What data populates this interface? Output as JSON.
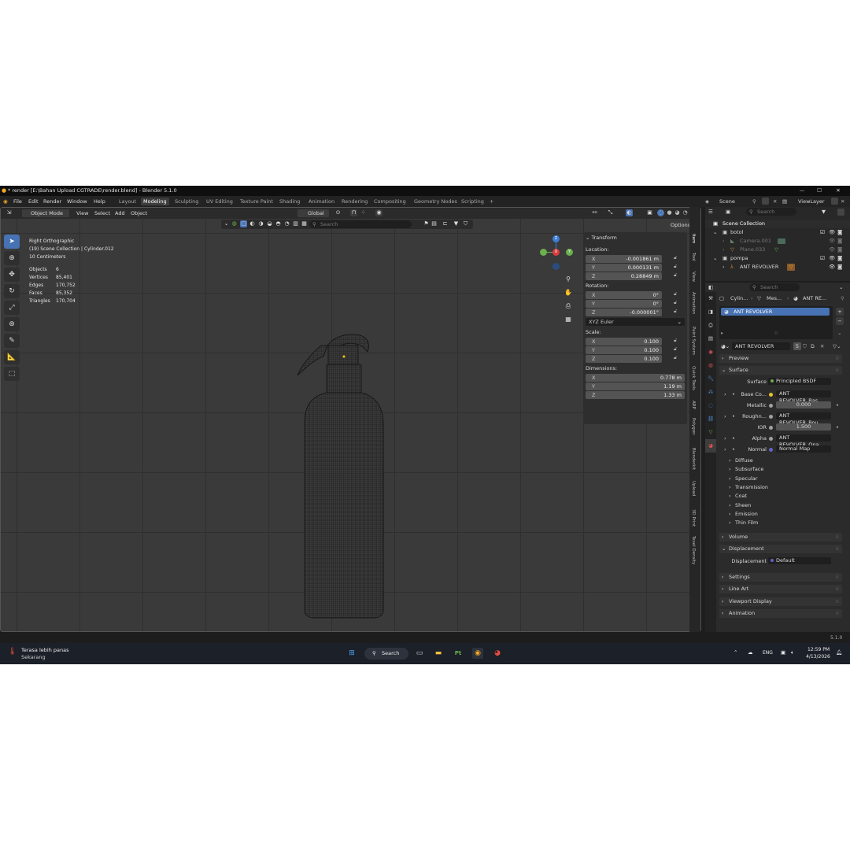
{
  "window": {
    "title": "* render [E:\\Bahan Upload CGTRADE\\render.blend] - Blender 5.1.0",
    "minimize": "—",
    "maximize": "☐",
    "close": "✕"
  },
  "menu": [
    "File",
    "Edit",
    "Render",
    "Window",
    "Help"
  ],
  "workspaces": [
    "Layout",
    "Modeling",
    "Sculpting",
    "UV Editing",
    "Texture Paint",
    "Shading",
    "Animation",
    "Rendering",
    "Compositing",
    "Geometry Nodes",
    "Scripting",
    "+"
  ],
  "active_workspace": "Modeling",
  "scene": {
    "name": "Scene",
    "view_layer": "ViewLayer"
  },
  "viewport": {
    "mode": "Object Mode",
    "menus": [
      "View",
      "Select",
      "Add",
      "Object"
    ],
    "orientation": "Global",
    "search_placeholder": "Search",
    "options": "Options",
    "overlay_title": "Right Orthographic",
    "overlay_collection": "(19) Scene Collection | Cylinder.012",
    "overlay_scale": "10 Centimeters",
    "stats": [
      {
        "k": "Objects",
        "v": "6"
      },
      {
        "k": "Vertices",
        "v": "85,401"
      },
      {
        "k": "Edges",
        "v": "170,752"
      },
      {
        "k": "Faces",
        "v": "85,352"
      },
      {
        "k": "Triangles",
        "v": "170,704"
      }
    ]
  },
  "gizmo": {
    "z": "Z",
    "y": "Y",
    "x": "X"
  },
  "npanel": {
    "header": "Transform",
    "location_label": "Location:",
    "location": [
      {
        "k": "X",
        "v": "-0.001861 m"
      },
      {
        "k": "Y",
        "v": "0.000131 m"
      },
      {
        "k": "Z",
        "v": "0.28849 m"
      }
    ],
    "rotation_label": "Rotation:",
    "rotation": [
      {
        "k": "X",
        "v": "0°"
      },
      {
        "k": "Y",
        "v": "0°"
      },
      {
        "k": "Z",
        "v": "-0.000001°"
      }
    ],
    "rotation_mode": "XYZ Euler",
    "scale_label": "Scale:",
    "scale": [
      {
        "k": "X",
        "v": "0.100"
      },
      {
        "k": "Y",
        "v": "0.100"
      },
      {
        "k": "Z",
        "v": "0.100"
      }
    ],
    "dimensions_label": "Dimensions:",
    "dimensions": [
      {
        "k": "X",
        "v": "0.778 m"
      },
      {
        "k": "Y",
        "v": "1.19 m"
      },
      {
        "k": "Z",
        "v": "1.33 m"
      }
    ],
    "tabs": [
      "Item",
      "Tool",
      "View",
      "Animation",
      "Paint System",
      "Quick Tools",
      "ARP",
      "Polygon",
      "Blenderkit",
      "Upload",
      "3D Print",
      "Texel Density"
    ]
  },
  "outliner": {
    "search_placeholder": "Search",
    "root": "Scene Collection",
    "items": [
      {
        "name": "botol",
        "level": 1
      },
      {
        "name": "Camera.001",
        "level": 2
      },
      {
        "name": "Plane.033",
        "level": 2
      },
      {
        "name": "pompa",
        "level": 1
      },
      {
        "name": "ANT REVOLVER",
        "level": 2
      }
    ]
  },
  "properties": {
    "search_placeholder": "Search",
    "breadcrumb": [
      "Cylin...",
      "Mes...",
      "ANT RE..."
    ],
    "material_slot": "ANT REVOLVER",
    "material_name": "ANT REVOLVER",
    "users": "5",
    "sections": {
      "preview": "Preview",
      "surface": "Surface"
    },
    "surface_label": "Surface",
    "surface_value": "Principled BSDF",
    "inputs": [
      {
        "label": "Base Co...",
        "value": "ANT REVOLVER_Bas...",
        "color": "#e5c229"
      },
      {
        "label": "Metallic",
        "value": "0.000",
        "color": "#a1a1a1"
      },
      {
        "label": "Roughn...",
        "value": "ANT REVOLVER_Rou...",
        "color": "#a1a1a1"
      },
      {
        "label": "IOR",
        "value": "1.500",
        "color": "#a1a1a1"
      },
      {
        "label": "Alpha",
        "value": "ANT REVOLVER_Opa...",
        "color": "#a1a1a1"
      },
      {
        "label": "Normal",
        "value": "Normal Map",
        "color": "#6363c7"
      }
    ],
    "subpanels": [
      "Diffuse",
      "Subsurface",
      "Specular",
      "Transmission",
      "Coat",
      "Sheen",
      "Emission",
      "Thin Film"
    ],
    "volume": "Volume",
    "displacement": "Displacement",
    "displacement_label": "Displacement",
    "displacement_value": "Default",
    "bottom": [
      "Settings",
      "Line Art",
      "Viewport Display",
      "Animation"
    ]
  },
  "version": "5.1.0",
  "taskbar": {
    "weather_title": "Terasa lebih panas",
    "weather_sub": "Sekarang",
    "search": "Search",
    "lang": "ENG",
    "time": "12:59 PM",
    "date": "4/13/2026"
  }
}
